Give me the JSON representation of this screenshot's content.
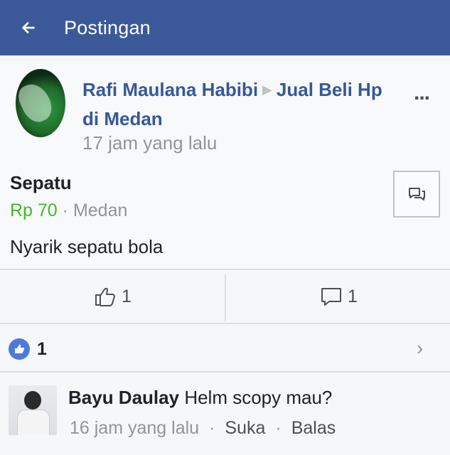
{
  "header": {
    "title": "Postingan"
  },
  "post": {
    "author": "Rafi Maulana Habibi",
    "group": "Jual Beli Hp di Medan",
    "time": "17 jam yang lalu",
    "more": "...",
    "product_title": "Sepatu",
    "price": "Rp 70",
    "location": "Medan",
    "description": "Nyarik sepatu bola",
    "like_count": "1",
    "comment_count": "1"
  },
  "reactions": {
    "count": "1"
  },
  "comment": {
    "author": "Bayu Daulay",
    "text": "Helm scopy mau?",
    "time": "16 jam yang lalu",
    "like_label": "Suka",
    "reply_label": "Balas"
  },
  "colors": {
    "header_bg": "#3b5998",
    "link": "#365899",
    "price": "#42b72a"
  },
  "icons": [
    "back-arrow-icon",
    "message-icon",
    "thumbs-up-icon",
    "comment-icon",
    "like-reaction-icon",
    "chevron-right-icon"
  ]
}
